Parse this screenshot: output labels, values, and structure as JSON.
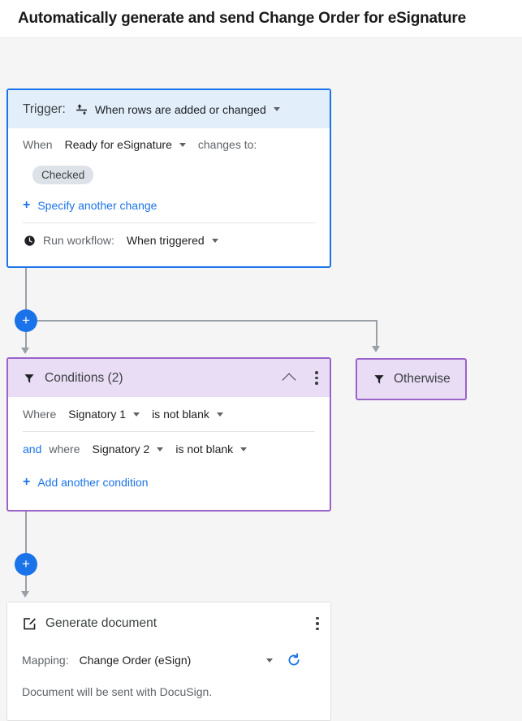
{
  "header": {
    "title": "Automatically generate and send Change Order for eSignature"
  },
  "trigger_card": {
    "label": "Trigger:",
    "icon": "import-rows-icon",
    "value": "When rows are added or changed",
    "when_label": "When",
    "column": "Ready for eSignature",
    "changes_to_label": "changes to:",
    "chip": "Checked",
    "add_change_link": "Specify another change",
    "run_workflow_label": "Run workflow:",
    "run_workflow_value": "When triggered",
    "run_icon": "clock-icon"
  },
  "conditions_card": {
    "icon": "filter-icon",
    "title": "Conditions (2)",
    "collapse_icon": "chevron-up-icon",
    "menu_icon": "kebab-menu-icon",
    "rows": [
      {
        "prefix": "Where",
        "conjunction": "",
        "field": "Signatory 1",
        "operator": "is not blank"
      },
      {
        "prefix": "where",
        "conjunction": "and",
        "field": "Signatory 2",
        "operator": "is not blank"
      }
    ],
    "add_condition_link": "Add another condition"
  },
  "otherwise_card": {
    "icon": "filter-icon",
    "label": "Otherwise"
  },
  "generate_card": {
    "icon": "compose-document-icon",
    "title": "Generate document",
    "menu_icon": "kebab-menu-icon",
    "mapping_label": "Mapping:",
    "mapping_value": "Change Order (eSign)",
    "refresh_icon": "refresh-icon",
    "note": "Document will be sent with DocuSign."
  },
  "connectors": {
    "add_step_label": "+"
  },
  "colors": {
    "trigger_border": "#1a73e8",
    "trigger_header": "#e2effb",
    "conditions_border": "#9a63c9",
    "conditions_header": "#e9ddf5",
    "link_blue": "#1a73e8",
    "connector_gray": "#9aa0a6",
    "canvas_bg": "#f5f5f5"
  }
}
